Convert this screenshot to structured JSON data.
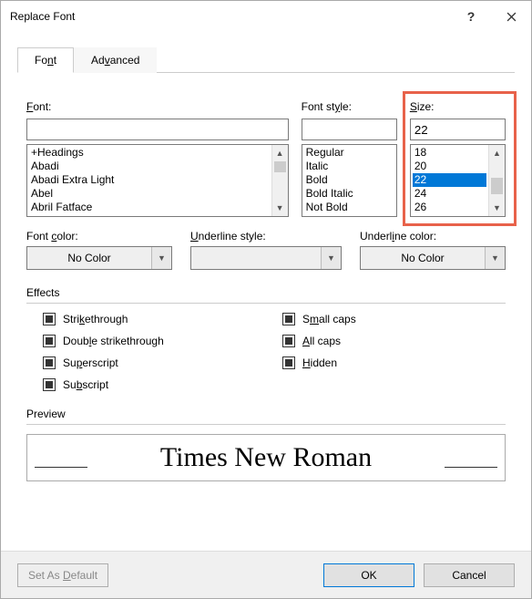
{
  "title": "Replace Font",
  "tabs": {
    "font": "Font",
    "advanced": "Advanced"
  },
  "labels": {
    "font": "Font:",
    "fontStyle": "Font style:",
    "size": "Size:",
    "fontColor": "Font color:",
    "underlineStyle": "Underline style:",
    "underlineColor": "Underline color:",
    "effects": "Effects",
    "preview": "Preview"
  },
  "fontInput": "",
  "fontList": [
    "+Headings",
    "Abadi",
    "Abadi Extra Light",
    "Abel",
    "Abril Fatface"
  ],
  "styleInput": "",
  "styleList": [
    "Regular",
    "Italic",
    "Bold",
    "Bold Italic",
    "Not Bold"
  ],
  "sizeInput": "22",
  "sizeList": [
    "18",
    "20",
    "22",
    "24",
    "26"
  ],
  "sizeSelected": "22",
  "fontColor": "No Color",
  "underlineStyle": "",
  "underlineColor": "No Color",
  "effectsLeft": {
    "strikethrough": "Strikethrough",
    "doubleStrikethrough": "Double strikethrough",
    "superscript": "Superscript",
    "subscript": "Subscript"
  },
  "effectsRight": {
    "smallCaps": "Small caps",
    "allCaps": "All caps",
    "hidden": "Hidden"
  },
  "previewText": "Times New Roman",
  "buttons": {
    "setDefault": "Set As Default",
    "ok": "OK",
    "cancel": "Cancel"
  }
}
